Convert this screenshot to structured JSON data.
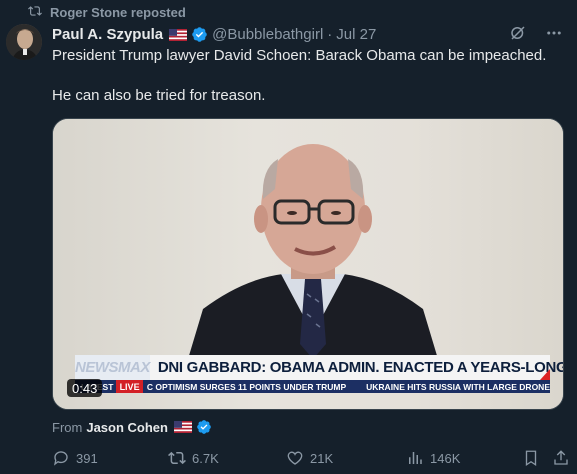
{
  "repost": {
    "label": "Roger Stone reposted",
    "icon": "repost-icon"
  },
  "author": {
    "name": "Paul A. Szypula",
    "flag": "us-flag-icon",
    "verified_icon": "verified-badge-icon",
    "handle": "@Bubblebathgirl",
    "separator": "·",
    "date": "Jul 27"
  },
  "tweet": {
    "paragraphs": [
      "President Trump lawyer David Schoen: Barack Obama can be impeached.",
      "He can also be tried for treason."
    ]
  },
  "video": {
    "network": "NEWSMAX",
    "headline": "DNI GABBARD: OBAMA ADMIN. ENACTED A YEARS-LONG COUP",
    "ticker_latest": "LATEST",
    "ticker_live": "LIVE",
    "ticker_item1": "C OPTIMISM SURGES 11 POINTS UNDER TRUMP",
    "ticker_item2": "UKRAINE HITS RUSSIA WITH LARGE DRONE",
    "duration": "0:43"
  },
  "from": {
    "label": "From",
    "name": "Jason Cohen",
    "flag": "us-flag-icon",
    "verified_icon": "verified-badge-icon"
  },
  "actions": {
    "replies": "391",
    "reposts": "6.7K",
    "likes": "21K",
    "views": "146K"
  },
  "colors": {
    "background": "#15202b",
    "verified": "#1d9bf0",
    "muted": "#8b98a5",
    "text": "#e7e9ea"
  }
}
